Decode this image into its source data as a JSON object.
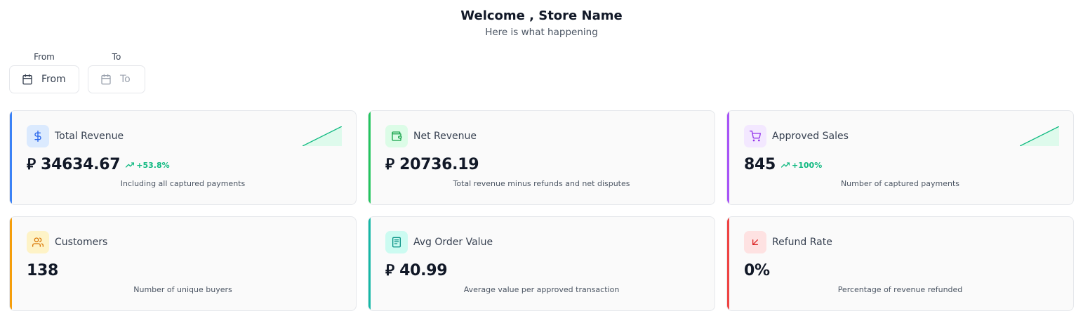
{
  "header": {
    "title": "Welcome , Store Name",
    "subtitle": "Here is what happening"
  },
  "filters": {
    "from": {
      "label": "From",
      "placeholder": "From",
      "icon": "calendar-icon"
    },
    "to": {
      "label": "To",
      "placeholder": "To",
      "icon": "calendar-icon",
      "disabled": true
    }
  },
  "colors": {
    "blue": "#3b82f6",
    "green": "#22c55e",
    "purple": "#a855f7",
    "amber": "#f59e0b",
    "teal": "#14b8a6",
    "red": "#ef4444",
    "trend_up": "#10b981"
  },
  "cards": [
    {
      "title": "Total Revenue",
      "value": "⃁ 34634.67",
      "trend": "+53.8%",
      "description": "Including all captured payments",
      "icon": "dollar-icon",
      "accent": "#3b82f6",
      "has_sparkline": true
    },
    {
      "title": "Net Revenue",
      "value": "⃁ 20736.19",
      "description": "Total revenue minus refunds and net disputes",
      "icon": "wallet-icon",
      "accent": "#22c55e"
    },
    {
      "title": "Approved Sales",
      "value": "845",
      "trend": "+100%",
      "description": "Number of captured payments",
      "icon": "cart-icon",
      "accent": "#a855f7",
      "has_sparkline": true
    },
    {
      "title": "Customers",
      "value": "138",
      "description": "Number of unique buyers",
      "icon": "users-icon",
      "accent": "#f59e0b"
    },
    {
      "title": "Avg Order Value",
      "value": "⃁ 40.99",
      "description": "Average value per approved transaction",
      "icon": "receipt-icon",
      "accent": "#14b8a6"
    },
    {
      "title": "Refund Rate",
      "value": "0%",
      "description": "Percentage of revenue refunded",
      "icon": "arrow-down-left-icon",
      "accent": "#ef4444"
    }
  ]
}
